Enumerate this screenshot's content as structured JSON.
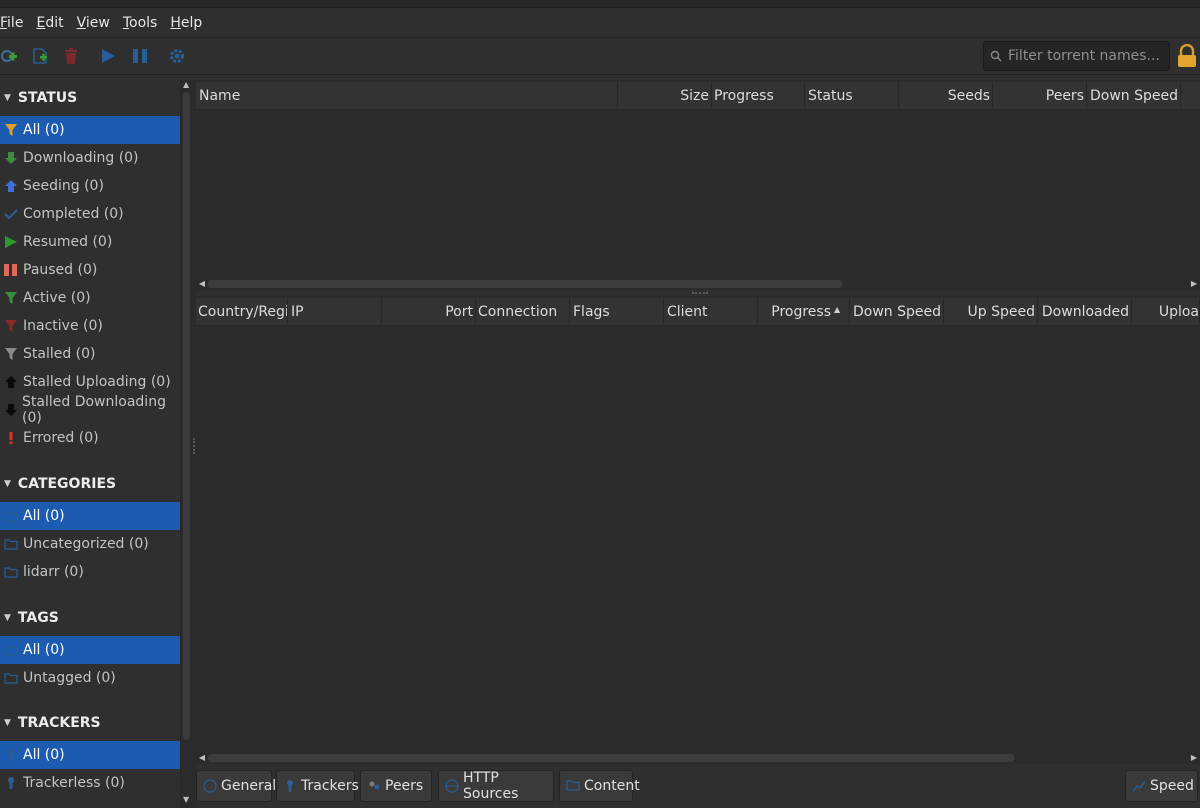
{
  "menu": [
    {
      "mnemonic": "F",
      "rest": "ile"
    },
    {
      "mnemonic": "E",
      "rest": "dit"
    },
    {
      "mnemonic": "V",
      "rest": "iew"
    },
    {
      "mnemonic": "T",
      "rest": "ools"
    },
    {
      "mnemonic": "H",
      "rest": "elp"
    }
  ],
  "toolbar": {
    "icons": [
      "add-torrent-link-icon",
      "add-torrent-file-icon",
      "delete-icon",
      "resume-icon",
      "pause-icon",
      "options-gear-icon"
    ],
    "filter_placeholder": "Filter torrent names..."
  },
  "sidebar": {
    "status": {
      "title": "STATUS",
      "items": [
        "All (0)",
        "Downloading (0)",
        "Seeding (0)",
        "Completed (0)",
        "Resumed (0)",
        "Paused (0)",
        "Active (0)",
        "Inactive (0)",
        "Stalled (0)",
        "Stalled Uploading (0)",
        "Stalled Downloading (0)",
        "Errored (0)"
      ]
    },
    "categories": {
      "title": "CATEGORIES",
      "items": [
        "All (0)",
        "Uncategorized (0)",
        "lidarr (0)"
      ]
    },
    "tags": {
      "title": "TAGS",
      "items": [
        "All (0)",
        "Untagged (0)"
      ]
    },
    "trackers": {
      "title": "TRACKERS",
      "items": [
        "All (0)",
        "Trackerless (0)"
      ]
    }
  },
  "torrent_table": {
    "columns": [
      "Name",
      "Size",
      "Progress",
      "Status",
      "Seeds",
      "Peers",
      "Down Speed"
    ]
  },
  "peers_table": {
    "columns": [
      "Country/Regio",
      "IP",
      "Port",
      "Connection",
      "Flags",
      "Client",
      "Progress",
      "Down Speed",
      "Up Speed",
      "Downloaded",
      "Uploa"
    ]
  },
  "bottom_tabs": [
    "General",
    "Trackers",
    "Peers",
    "HTTP Sources",
    "Content"
  ],
  "speed_button": "Speed",
  "colors": {
    "selection": "#1c5baf",
    "downloading": "#3d8c3d",
    "seeding": "#3b6fd6",
    "errored": "#e03030",
    "paused": "#e06a5a"
  }
}
